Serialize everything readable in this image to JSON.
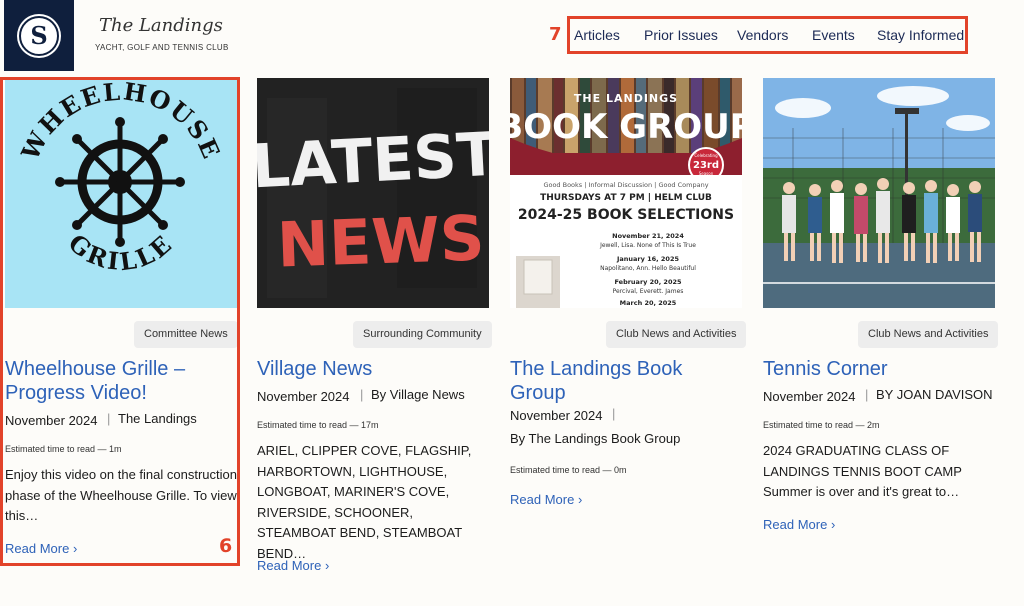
{
  "brand": {
    "logo_letter": "S",
    "title": "The Landings",
    "subtitle": "Yacht, Golf and Tennis Club"
  },
  "annotations": {
    "nav_number": "7",
    "card_number": "6"
  },
  "nav": {
    "items": [
      "Articles",
      "Prior Issues",
      "Vendors",
      "Events",
      "Stay Informed"
    ]
  },
  "cards": [
    {
      "image": {
        "alt": "Wheelhouse Grille logo",
        "lines": [
          "WHEELHOUSE",
          "GRILLE"
        ]
      },
      "category": "Committee News",
      "title": "Wheelhouse Grille – Progress Video!",
      "date": "November 2024",
      "author": "The Landings",
      "estimate": "Estimated time to read — 1m",
      "excerpt": "Enjoy this video on the final construction phase of the Wheelhouse Grille. To view this…",
      "read_more": "Read More"
    },
    {
      "image": {
        "alt": "Latest News chalkboard",
        "lines": [
          "LATEST",
          "NEWS"
        ]
      },
      "category": "Surrounding Community",
      "title": "Village News",
      "date": "November 2024",
      "author": "By Village News",
      "estimate": "Estimated time to read — 17m",
      "excerpt": "ARIEL, CLIPPER COVE, FLAGSHIP, HARBORTOWN, LIGHTHOUSE, LONGBOAT, MARINER'S COVE, RIVERSIDE, SCHOONER, STEAMBOAT BEND, STEAMBOAT BEND…",
      "read_more": "Read More"
    },
    {
      "image": {
        "alt": "The Landings Book Group flyer",
        "heading_small": "THE LANDINGS",
        "heading_big": "BOOK GROUP",
        "season_top": "Celebrating",
        "season_num": "23rd",
        "season_bottom": "Season",
        "tagline": "Good Books | Informal Discussion | Good Company",
        "when": "THURSDAYS AT 7 PM | HELM CLUB",
        "selections": "2024-25 BOOK SELECTIONS",
        "books": [
          {
            "date": "November 21, 2024",
            "info": "Jewell, Lisa. None of This Is True"
          },
          {
            "date": "January 16, 2025",
            "info": "Napolitano, Ann. Hello Beautiful"
          },
          {
            "date": "February 20, 2025",
            "info": "Percival, Everett. James"
          },
          {
            "date": "March 20, 2025",
            "info": ""
          }
        ]
      },
      "category": "Club News and Activities",
      "title": "The Landings Book Group",
      "date": "November 2024",
      "author": "By The Landings Book Group",
      "estimate": "Estimated time to read — 0m",
      "excerpt": "",
      "read_more": "Read More"
    },
    {
      "image": {
        "alt": "Tennis group photo on courts"
      },
      "category": "Club News and Activities",
      "title": "Tennis Corner",
      "date": "November 2024",
      "author": "BY JOAN DAVISON",
      "estimate": "Estimated time to read — 2m",
      "excerpt": "2024 GRADUATING CLASS OF LANDINGS TENNIS BOOT CAMP Summer is over and it's great to…",
      "read_more": "Read More"
    }
  ],
  "colors": {
    "accent": "#2e62b8",
    "annotation": "#e2432a",
    "navy": "#0f1f3d",
    "badge_bg": "#ededed"
  }
}
